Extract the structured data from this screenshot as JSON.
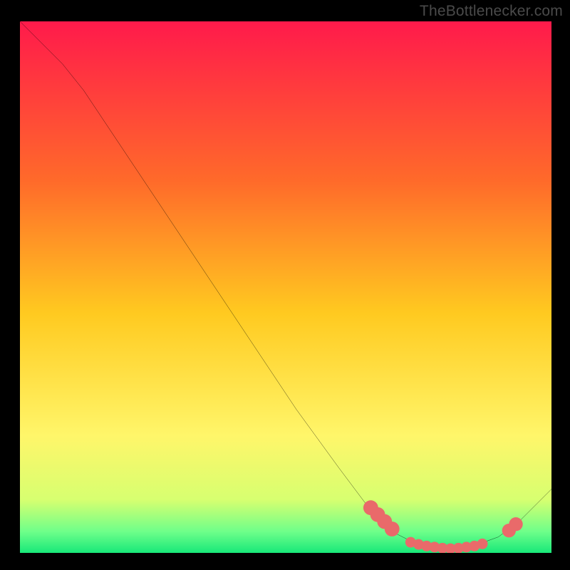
{
  "attribution": "TheBottlenecker.com",
  "chart_data": {
    "type": "line",
    "title": "",
    "xlabel": "",
    "ylabel": "",
    "xlim": [
      0,
      100
    ],
    "ylim": [
      0,
      100
    ],
    "gradient_stops": [
      {
        "offset": 0,
        "color": "#ff1a4b"
      },
      {
        "offset": 0.3,
        "color": "#ff6a2a"
      },
      {
        "offset": 0.55,
        "color": "#ffca20"
      },
      {
        "offset": 0.78,
        "color": "#fff66a"
      },
      {
        "offset": 0.9,
        "color": "#d7ff70"
      },
      {
        "offset": 0.96,
        "color": "#6eff8a"
      },
      {
        "offset": 1.0,
        "color": "#18e879"
      }
    ],
    "series": [
      {
        "name": "curve",
        "points": [
          {
            "x": 0,
            "y": 100
          },
          {
            "x": 4,
            "y": 96
          },
          {
            "x": 8,
            "y": 92
          },
          {
            "x": 12,
            "y": 87
          },
          {
            "x": 16,
            "y": 81
          },
          {
            "x": 20,
            "y": 75
          },
          {
            "x": 28,
            "y": 63
          },
          {
            "x": 36,
            "y": 51
          },
          {
            "x": 44,
            "y": 39
          },
          {
            "x": 52,
            "y": 27
          },
          {
            "x": 60,
            "y": 16
          },
          {
            "x": 66,
            "y": 8
          },
          {
            "x": 70,
            "y": 4
          },
          {
            "x": 75,
            "y": 1.5
          },
          {
            "x": 80,
            "y": 0.8
          },
          {
            "x": 85,
            "y": 1.2
          },
          {
            "x": 90,
            "y": 3
          },
          {
            "x": 94,
            "y": 6
          },
          {
            "x": 100,
            "y": 12
          }
        ]
      }
    ],
    "markers": [
      {
        "x": 66,
        "y": 8.5,
        "r": 1.4
      },
      {
        "x": 67.3,
        "y": 7.2,
        "r": 1.4
      },
      {
        "x": 68.6,
        "y": 5.9,
        "r": 1.4
      },
      {
        "x": 70,
        "y": 4.5,
        "r": 1.4
      },
      {
        "x": 73.5,
        "y": 2.0,
        "r": 1.0
      },
      {
        "x": 75,
        "y": 1.6,
        "r": 1.0
      },
      {
        "x": 76.5,
        "y": 1.3,
        "r": 1.0
      },
      {
        "x": 78,
        "y": 1.1,
        "r": 1.0
      },
      {
        "x": 79.5,
        "y": 0.9,
        "r": 1.0
      },
      {
        "x": 81,
        "y": 0.8,
        "r": 1.0
      },
      {
        "x": 82.5,
        "y": 0.9,
        "r": 1.0
      },
      {
        "x": 84,
        "y": 1.1,
        "r": 1.0
      },
      {
        "x": 85.5,
        "y": 1.3,
        "r": 1.0
      },
      {
        "x": 87,
        "y": 1.7,
        "r": 1.0
      },
      {
        "x": 92,
        "y": 4.2,
        "r": 1.3
      },
      {
        "x": 93.3,
        "y": 5.4,
        "r": 1.3
      }
    ],
    "marker_color": "#e96a6a"
  }
}
